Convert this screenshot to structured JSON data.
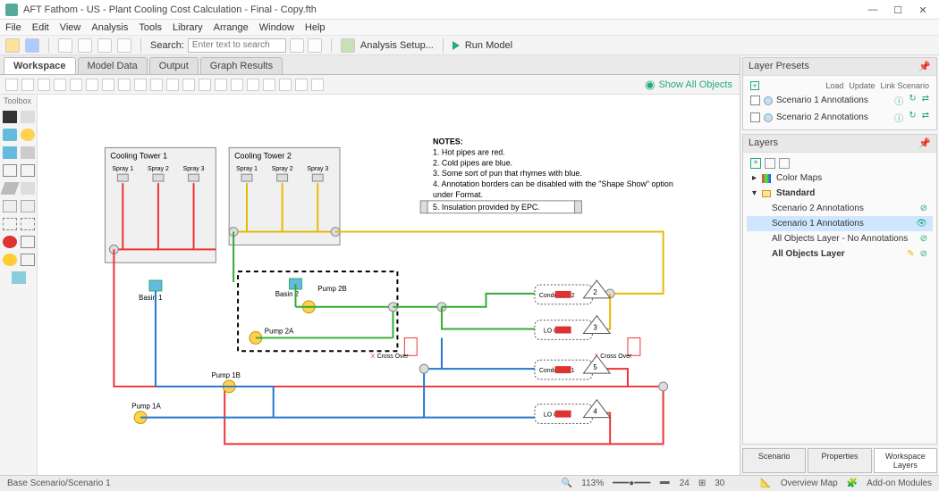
{
  "app": {
    "title": "AFT Fathom - US - Plant Cooling Cost Calculation - Final - Copy.fth"
  },
  "menus": [
    "File",
    "Edit",
    "View",
    "Analysis",
    "Tools",
    "Library",
    "Arrange",
    "Window",
    "Help"
  ],
  "toolbar": {
    "search_label": "Search:",
    "search_placeholder": "Enter text to search",
    "analysis_setup": "Analysis Setup...",
    "run_model": "Run Model"
  },
  "tabs": {
    "workspace": "Workspace",
    "modeldata": "Model Data",
    "output": "Output",
    "graph": "Graph Results"
  },
  "wsbar": {
    "showall": "Show All Objects"
  },
  "toolbox": {
    "title": "Toolbox"
  },
  "diagram": {
    "ct1": {
      "title": "Cooling Tower 1",
      "sprays": [
        "Spray 1",
        "Spray 2",
        "Spray 3"
      ]
    },
    "ct2": {
      "title": "Cooling Tower 2",
      "sprays": [
        "Spray 1",
        "Spray 2",
        "Spray 3"
      ]
    },
    "basin1": "Basin 1",
    "basin2": "Basin 2",
    "pump2B": "Pump 2B",
    "pump2A": "Pump 2A",
    "pump1B": "Pump 1B",
    "pump1A": "Pump 1A",
    "cond2": "Condenser 2",
    "cond1": "Condenser 1",
    "loch2": "LO Clr 2",
    "loch1": "LO Clr 1",
    "cross1": "Cross Over",
    "cross2": "Cross Over",
    "notes_title": "NOTES:",
    "notes": {
      "l1": "1. Hot pipes are red.",
      "l2": "2. Cold pipes are blue.",
      "l3": "3. Some sort of pun that rhymes with blue.",
      "l4": "4. Annotation borders can be disabled with the \"Shape Show\" option",
      "l4b": "    under Format.",
      "l5": "5. Insulation provided by EPC."
    }
  },
  "right": {
    "presets_hdr": "Layer Presets",
    "preset_cols": {
      "load": "Load",
      "update": "Update",
      "link": "Link Scenario"
    },
    "presets": [
      "Scenario 1 Annotations",
      "Scenario 2 Annotations"
    ],
    "layers_hdr": "Layers",
    "group_colormaps": "Color Maps",
    "group_standard": "Standard",
    "layers": {
      "l1": "Scenario 2 Annotations",
      "l2": "Scenario 1 Annotations",
      "l3": "All Objects Layer - No Annotations",
      "l4": "All Objects Layer"
    },
    "tabs": {
      "scenario": "Scenario",
      "properties": "Properties",
      "wslayers": "Workspace Layers"
    }
  },
  "status": {
    "left": "Base Scenario/Scenario 1",
    "zoom": "113%",
    "counts": {
      "pipes": "24",
      "junctions": "30"
    },
    "overview": "Overview Map",
    "addon": "Add-on Modules"
  }
}
